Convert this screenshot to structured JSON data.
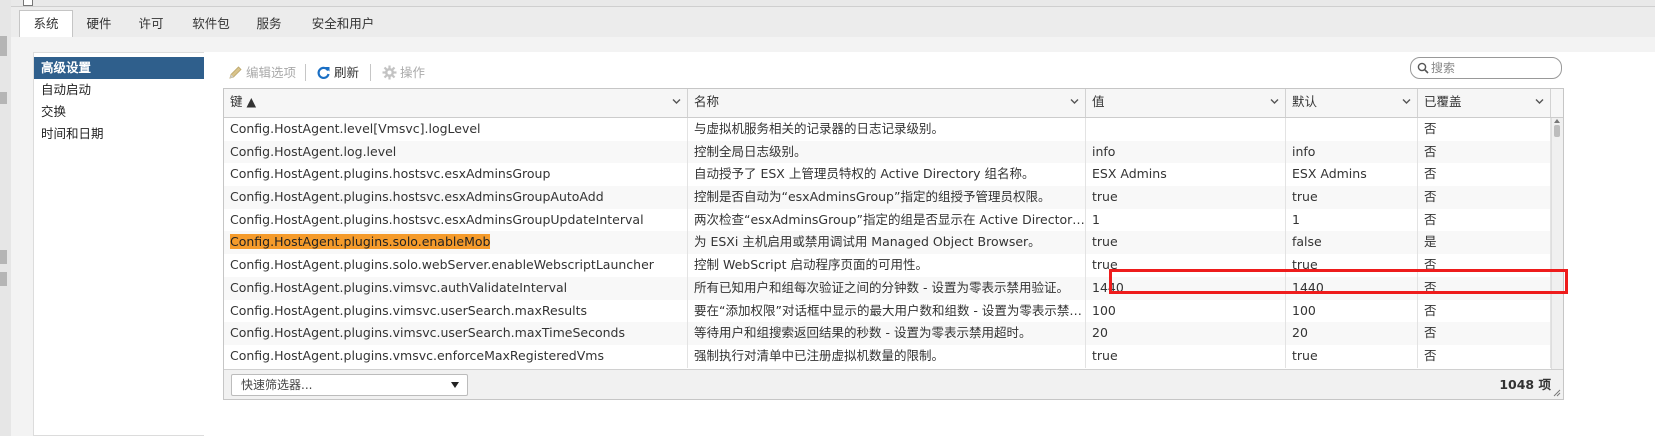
{
  "tabs": [
    {
      "label": "系统",
      "active": true
    },
    {
      "label": "硬件",
      "active": false
    },
    {
      "label": "许可",
      "active": false
    },
    {
      "label": "软件包",
      "active": false
    },
    {
      "label": "服务",
      "active": false
    },
    {
      "label": "安全和用户",
      "active": false
    }
  ],
  "sidebar": {
    "items": [
      {
        "label": "高级设置",
        "active": true
      },
      {
        "label": "自动启动",
        "active": false
      },
      {
        "label": "交换",
        "active": false
      },
      {
        "label": "时间和日期",
        "active": false
      }
    ]
  },
  "toolbar": {
    "edit_label": "编辑选项",
    "refresh_label": "刷新",
    "actions_label": "操作",
    "search_placeholder": "搜索"
  },
  "table": {
    "columns": [
      {
        "label": "键 ▲",
        "sorted": "ascending"
      },
      {
        "label": "名称"
      },
      {
        "label": "值"
      },
      {
        "label": "默认"
      },
      {
        "label": "已覆盖"
      }
    ],
    "rows": [
      {
        "key": "Config.HostAgent.level[Vmsvc].logLevel",
        "name": "与虚拟机服务相关的记录器的日志记录级别。",
        "value": "",
        "default": "",
        "overridden": "否"
      },
      {
        "key": "Config.HostAgent.log.level",
        "name": "控制全局日志级别。",
        "value": "info",
        "default": "info",
        "overridden": "否"
      },
      {
        "key": "Config.HostAgent.plugins.hostsvc.esxAdminsGroup",
        "name": "自动授予了 ESX 上管理员特权的 Active Directory 组名称。",
        "value": "ESX Admins",
        "default": "ESX Admins",
        "overridden": "否"
      },
      {
        "key": "Config.HostAgent.plugins.hostsvc.esxAdminsGroupAutoAdd",
        "name": "控制是否自动为“esxAdminsGroup”指定的组授予管理员权限。",
        "value": "true",
        "default": "true",
        "overridden": "否"
      },
      {
        "key": "Config.HostAgent.plugins.hostsvc.esxAdminsGroupUpdateInterval",
        "name": "两次检查“esxAdminsGroup”指定的组是否显示在 Active Directory 中的时…",
        "value": "1",
        "default": "1",
        "overridden": "否"
      },
      {
        "key": "Config.HostAgent.plugins.solo.enableMob",
        "name": "为 ESXi 主机启用或禁用调试用 Managed Object Browser。",
        "value": "true",
        "default": "false",
        "overridden": "是",
        "highlighted": true
      },
      {
        "key": "Config.HostAgent.plugins.solo.webServer.enableWebscriptLauncher",
        "name": "控制 WebScript 启动程序页面的可用性。",
        "value": "true",
        "default": "true",
        "overridden": "否"
      },
      {
        "key": "Config.HostAgent.plugins.vimsvc.authValidateInterval",
        "name": "所有已知用户和组每次验证之间的分钟数 - 设置为零表示禁用验证。",
        "value": "1440",
        "default": "1440",
        "overridden": "否"
      },
      {
        "key": "Config.HostAgent.plugins.vimsvc.userSearch.maxResults",
        "name": "要在“添加权限”对话框中显示的最大用户数和组数 - 设置为零表示禁用极限…",
        "value": "100",
        "default": "100",
        "overridden": "否"
      },
      {
        "key": "Config.HostAgent.plugins.vimsvc.userSearch.maxTimeSeconds",
        "name": "等待用户和组搜索返回结果的秒数 - 设置为零表示禁用超时。",
        "value": "20",
        "default": "20",
        "overridden": "否"
      },
      {
        "key": "Config.HostAgent.plugins.vmsvc.enforceMaxRegisteredVms",
        "name": "强制执行对清单中已注册虚拟机数量的限制。",
        "value": "true",
        "default": "true",
        "overridden": "否"
      }
    ]
  },
  "footer": {
    "filter_label": "快速筛选器...",
    "count_label": "1048 项"
  },
  "colors": {
    "selected_bg": "#2f5f8c",
    "highlight_key": "#f59b2b",
    "callout_border": "#ee1c1c",
    "refresh_icon": "#1a6fc4"
  },
  "icons": [
    "pencil-icon",
    "refresh-icon",
    "gear-icon",
    "search-icon",
    "chevron-down-icon",
    "dropdown-arrow-icon"
  ]
}
